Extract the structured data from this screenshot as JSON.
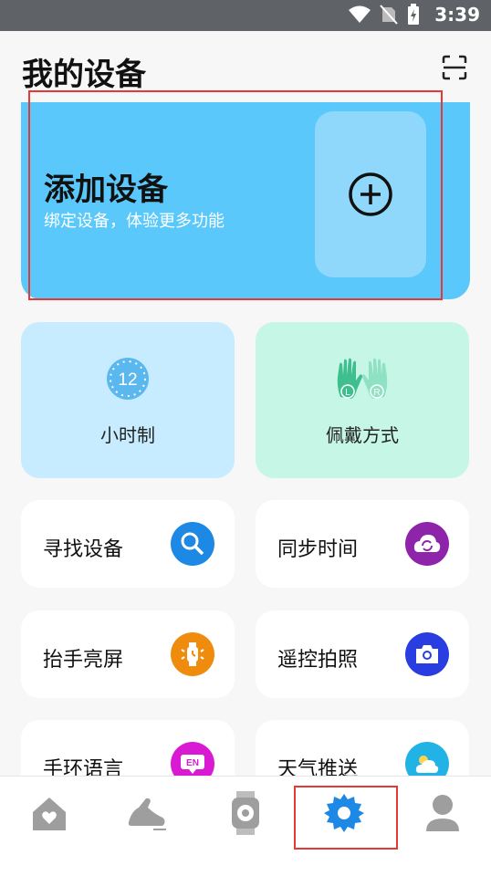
{
  "status_bar": {
    "time": "3:39"
  },
  "header": {
    "title": "我的设备"
  },
  "add_device": {
    "title": "添加设备",
    "subtitle": "绑定设备，体验更多功能"
  },
  "feature_cards": [
    {
      "label": "小时制",
      "icon": "clock-12-icon"
    },
    {
      "label": "佩戴方式",
      "icon": "hands-lr-icon"
    }
  ],
  "menu_items": [
    {
      "label": "寻找设备",
      "icon": "search-icon",
      "color": "#1e88e5"
    },
    {
      "label": "同步时间",
      "icon": "sync-cloud-icon",
      "color": "#8e24aa"
    },
    {
      "label": "抬手亮屏",
      "icon": "watch-raise-icon",
      "color": "#ef8c0e"
    },
    {
      "label": "遥控拍照",
      "icon": "camera-icon",
      "color": "#2a3de0"
    },
    {
      "label": "手环语言",
      "icon": "language-en-icon",
      "color": "#d81bd2"
    },
    {
      "label": "天气推送",
      "icon": "weather-icon",
      "color": "#22b3e6"
    }
  ],
  "clock_label": "12",
  "hand_labels": {
    "left": "L",
    "right": "R"
  },
  "en_badge": "EN",
  "tabbar": {
    "items": [
      {
        "name": "home-tab",
        "icon": "home-heart-icon"
      },
      {
        "name": "sport-tab",
        "icon": "running-shoe-icon"
      },
      {
        "name": "watch-tab",
        "icon": "smartwatch-icon"
      },
      {
        "name": "device-tab",
        "icon": "gear-icon",
        "active": true
      },
      {
        "name": "profile-tab",
        "icon": "user-icon"
      }
    ]
  },
  "colors": {
    "accent": "#1e88e5",
    "card_blue": "#5ac8fa",
    "highlight": "#e53935"
  }
}
